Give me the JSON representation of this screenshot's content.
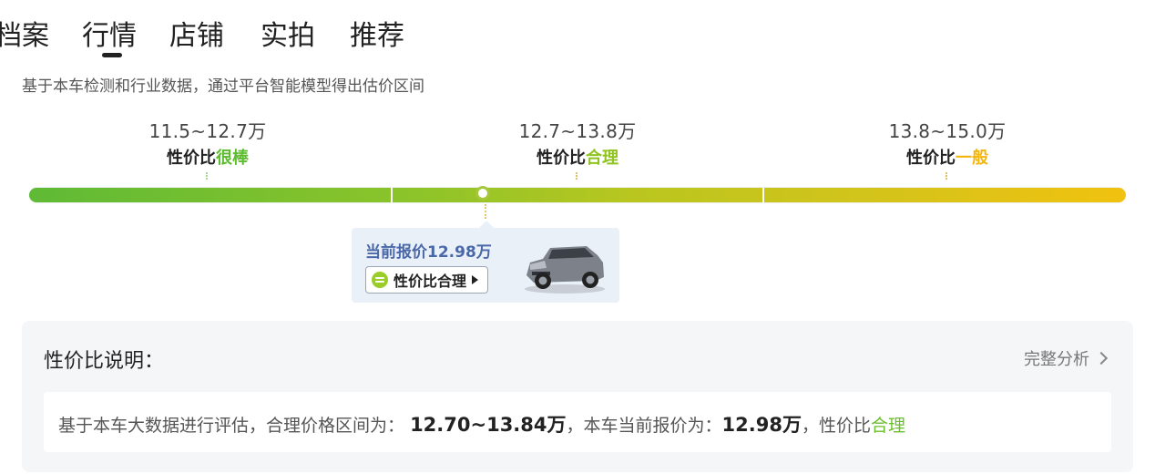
{
  "tabs": [
    {
      "label": "档案",
      "active": false
    },
    {
      "label": "行情",
      "active": true
    },
    {
      "label": "店铺",
      "active": false
    },
    {
      "label": "实拍",
      "active": false
    },
    {
      "label": "推荐",
      "active": false
    }
  ],
  "subtitle": "基于本车检测和行业数据，通过平台智能模型得出估价区间",
  "tiers": [
    {
      "range": "11.5~12.7万",
      "prefix": "性价比",
      "verdict": "很棒"
    },
    {
      "range": "12.7~13.8万",
      "prefix": "性价比",
      "verdict": "合理"
    },
    {
      "range": "13.8~15.0万",
      "prefix": "性价比",
      "verdict": "一般"
    }
  ],
  "current": {
    "title": "当前报价12.98万",
    "verdict_label": "性价比合理",
    "price_value": 12.98
  },
  "explain": {
    "title": "性价比说明：",
    "link": "完整分析",
    "text_prefix": "基于本车大数据进行评估，合理价格区间为：",
    "range": "12.70~13.84万",
    "text_mid": "，本车当前报价为：",
    "price": "12.98万",
    "text_suffix": "，性价比",
    "verdict": "合理"
  },
  "colors": {
    "good": "#5dbb2f",
    "fair": "#8fc31f",
    "average": "#f2b60f"
  },
  "icons": [
    "equals-circle-icon",
    "play-arrow-icon",
    "chevron-right-icon",
    "car-image"
  ]
}
